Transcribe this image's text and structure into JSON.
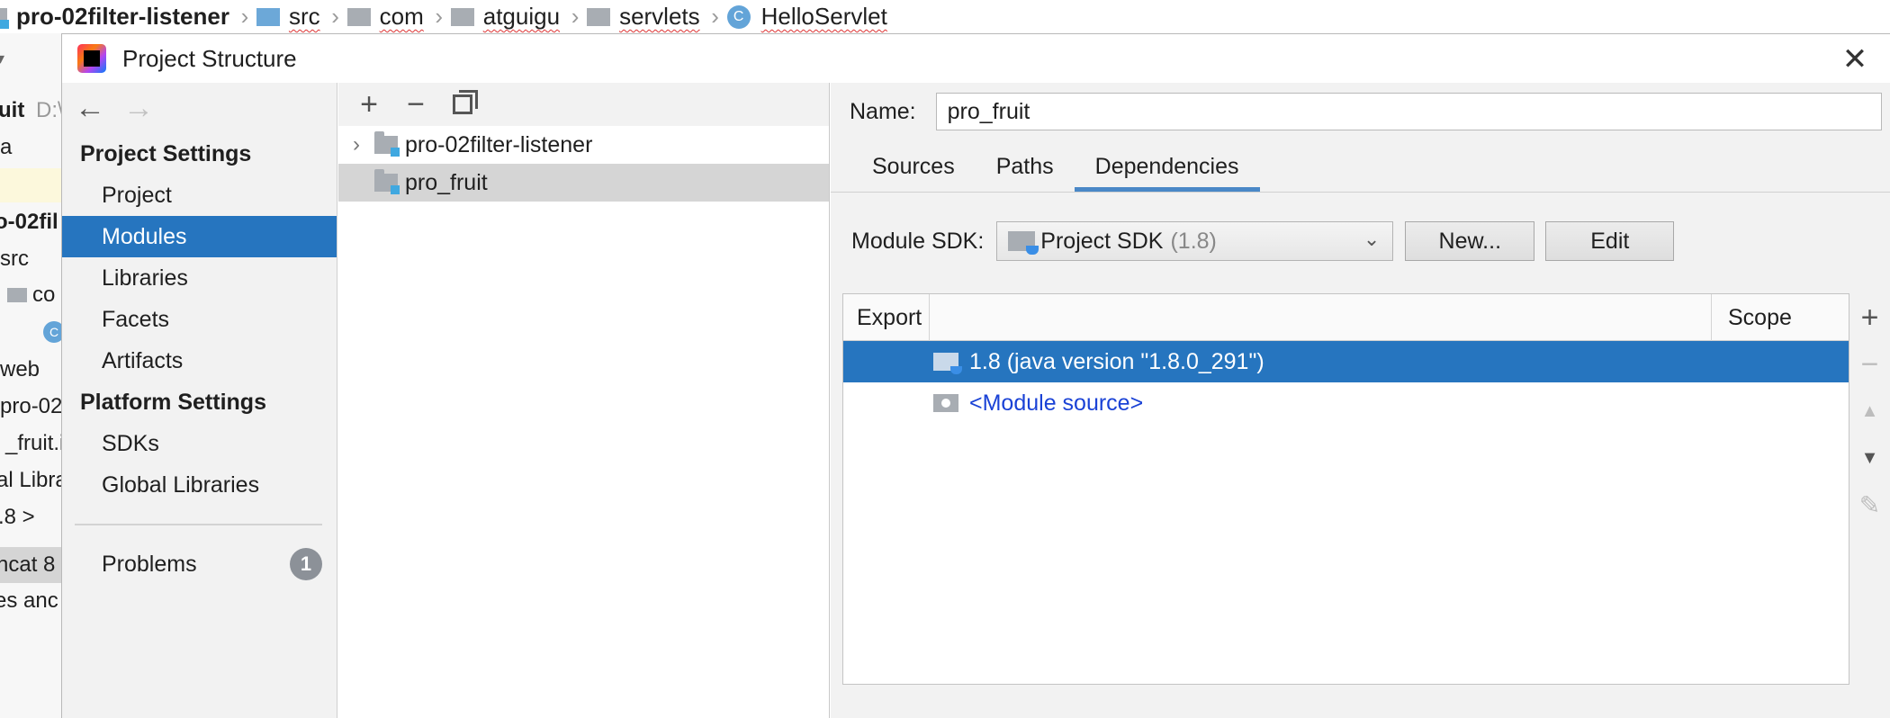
{
  "breadcrumb": {
    "items": [
      "pro-02filter-listener",
      "src",
      "com",
      "atguigu",
      "servlets",
      "HelloServlet"
    ],
    "separator": "›",
    "class_icon_letter": "C"
  },
  "left_ide": {
    "rows": [
      "uit",
      "D:\\",
      "a",
      "o-02fil",
      "src",
      "co",
      "C",
      "web",
      "pro-02",
      "_fruit.i",
      "al Libra",
      ".8 >",
      "ncat 8",
      "es anc"
    ]
  },
  "dialog": {
    "title": "Project Structure",
    "close_glyph": "✕"
  },
  "sidebar": {
    "back_glyph": "←",
    "forward_glyph": "→",
    "project_settings_header": "Project Settings",
    "project_settings_items": [
      "Project",
      "Modules",
      "Libraries",
      "Facets",
      "Artifacts"
    ],
    "platform_settings_header": "Platform Settings",
    "platform_settings_items": [
      "SDKs",
      "Global Libraries"
    ],
    "problems_label": "Problems",
    "problems_count": "1",
    "selected_item": "Modules"
  },
  "module_panel": {
    "toolbar": {
      "add_glyph": "+",
      "remove_glyph": "−"
    },
    "modules": [
      {
        "name": "pro-02filter-listener",
        "expandable": true,
        "selected": false
      },
      {
        "name": "pro_fruit",
        "expandable": false,
        "selected": true
      }
    ],
    "expand_glyph": "›"
  },
  "detail": {
    "name_label": "Name:",
    "name_value": "pro_fruit",
    "tabs": [
      "Sources",
      "Paths",
      "Dependencies"
    ],
    "active_tab": "Dependencies",
    "module_sdk_label": "Module SDK:",
    "module_sdk_value": "Project SDK",
    "module_sdk_version": "(1.8)",
    "chevron_glyph": "⌄",
    "new_button": "New...",
    "edit_button": "Edit",
    "table": {
      "col_export": "Export",
      "col_scope": "Scope",
      "rows": [
        {
          "label": "1.8 (java version \"1.8.0_291\")",
          "selected": true
        },
        {
          "label": "<Module source>",
          "selected": false
        }
      ]
    },
    "side_tools": {
      "add_glyph": "+",
      "remove_glyph": "−",
      "up_glyph": "▲",
      "down_glyph": "▼",
      "edit_glyph": "✎"
    }
  },
  "colors": {
    "selection": "#2675bf",
    "tab_underline": "#4a88c7",
    "badge": "#8c9198",
    "link": "#1a42d6"
  }
}
